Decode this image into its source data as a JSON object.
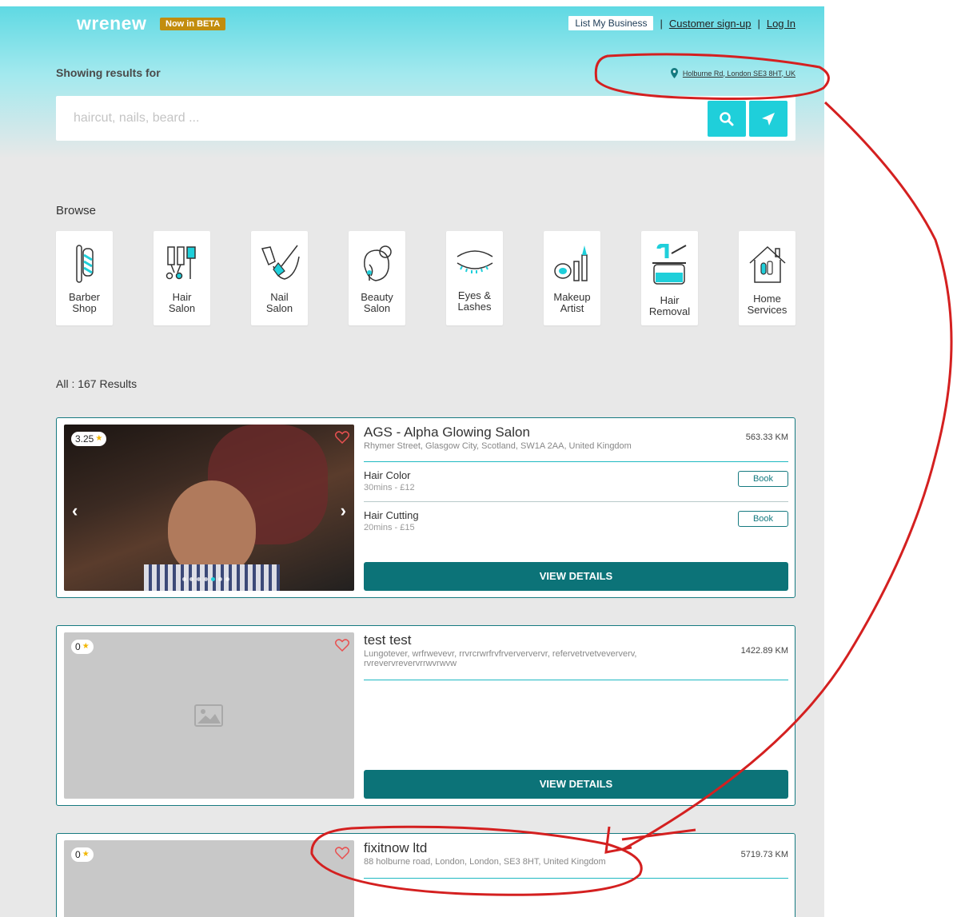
{
  "header": {
    "logo": "wrenew",
    "beta_badge": "Now in BETA",
    "nav": {
      "list_business": "List My Business",
      "customer_signup": "Customer sign-up",
      "login": "Log In",
      "separator": "|"
    }
  },
  "search": {
    "showing_label": "Showing results for",
    "location": "Holburne Rd, London SE3 8HT, UK",
    "placeholder": "haircut, nails, beard ...",
    "value": ""
  },
  "browse": {
    "title": "Browse",
    "categories": [
      {
        "label": "Barber\nShop",
        "icon": "barber-pole-icon"
      },
      {
        "label": "Hair\nSalon",
        "icon": "hair-dryer-comb-icon"
      },
      {
        "label": "Nail\nSalon",
        "icon": "nail-polish-icon"
      },
      {
        "label": "Beauty\nSalon",
        "icon": "woman-face-icon"
      },
      {
        "label": "Eyes &\nLashes",
        "icon": "eyelash-icon"
      },
      {
        "label": "Makeup\nArtist",
        "icon": "makeup-brushes-icon"
      },
      {
        "label": "Hair\nRemoval",
        "icon": "wax-pot-icon"
      },
      {
        "label": "Home\nServices",
        "icon": "house-icon"
      }
    ]
  },
  "results": {
    "summary": "All : 167 Results",
    "listings": [
      {
        "rating": "3.25",
        "name": "AGS - Alpha Glowing Salon",
        "address": "Rhymer Street, Glasgow City, Scotland, SW1A 2AA, United Kingdom",
        "distance": "563.33 KM",
        "services": [
          {
            "name": "Hair Color",
            "detail": "30mins - £12",
            "action": "Book"
          },
          {
            "name": "Hair Cutting",
            "detail": "20mins - £15",
            "action": "Book"
          }
        ],
        "cta": "VIEW DETAILS"
      },
      {
        "rating": "0",
        "name": "test test",
        "address": "Lungotever, wrfrwevevr, rrvrcrwrfrvfrverververvr, refervetrvetveververv, rvrevervrevervrrwvrwvw",
        "distance": "1422.89 KM",
        "services": [],
        "cta": "VIEW DETAILS"
      },
      {
        "rating": "0",
        "name": "fixitnow ltd",
        "address": "88 holburne road, London, London, SE3 8HT, United Kingdom",
        "distance": "5719.73 KM",
        "services": []
      }
    ]
  },
  "colors": {
    "accent": "#1fcfda",
    "primary_dark": "#0c7378",
    "beta": "#c28d0e",
    "annotation": "#d42020"
  }
}
